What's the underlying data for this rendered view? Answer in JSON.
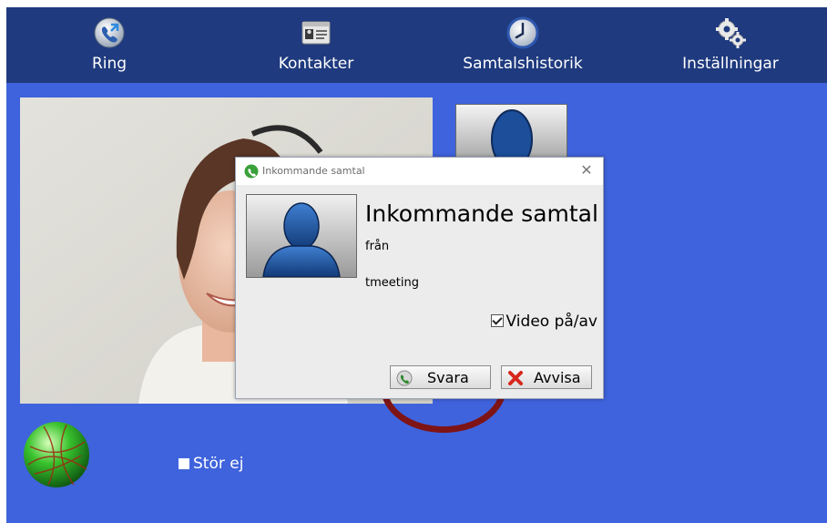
{
  "nav": [
    {
      "label": "Ring",
      "icon": "phone-call-icon"
    },
    {
      "label": "Kontakter",
      "icon": "contacts-card-icon"
    },
    {
      "label": "Samtalshistorik",
      "icon": "clock-icon"
    },
    {
      "label": "Inställningar",
      "icon": "gears-icon"
    }
  ],
  "status": {
    "dnd_label": "Stör ej"
  },
  "dialog": {
    "title": "Inkommande samtal",
    "heading": "Inkommande samtal",
    "from_label": "från",
    "caller": "tmeeting",
    "video_toggle_label": "Video på/av",
    "video_checked": true,
    "answer_label": "Svara",
    "reject_label": "Avvisa"
  },
  "colors": {
    "nav_bar": "#1f3a7e",
    "background": "#3f63dc",
    "highlight_ring": "#7e1416"
  }
}
